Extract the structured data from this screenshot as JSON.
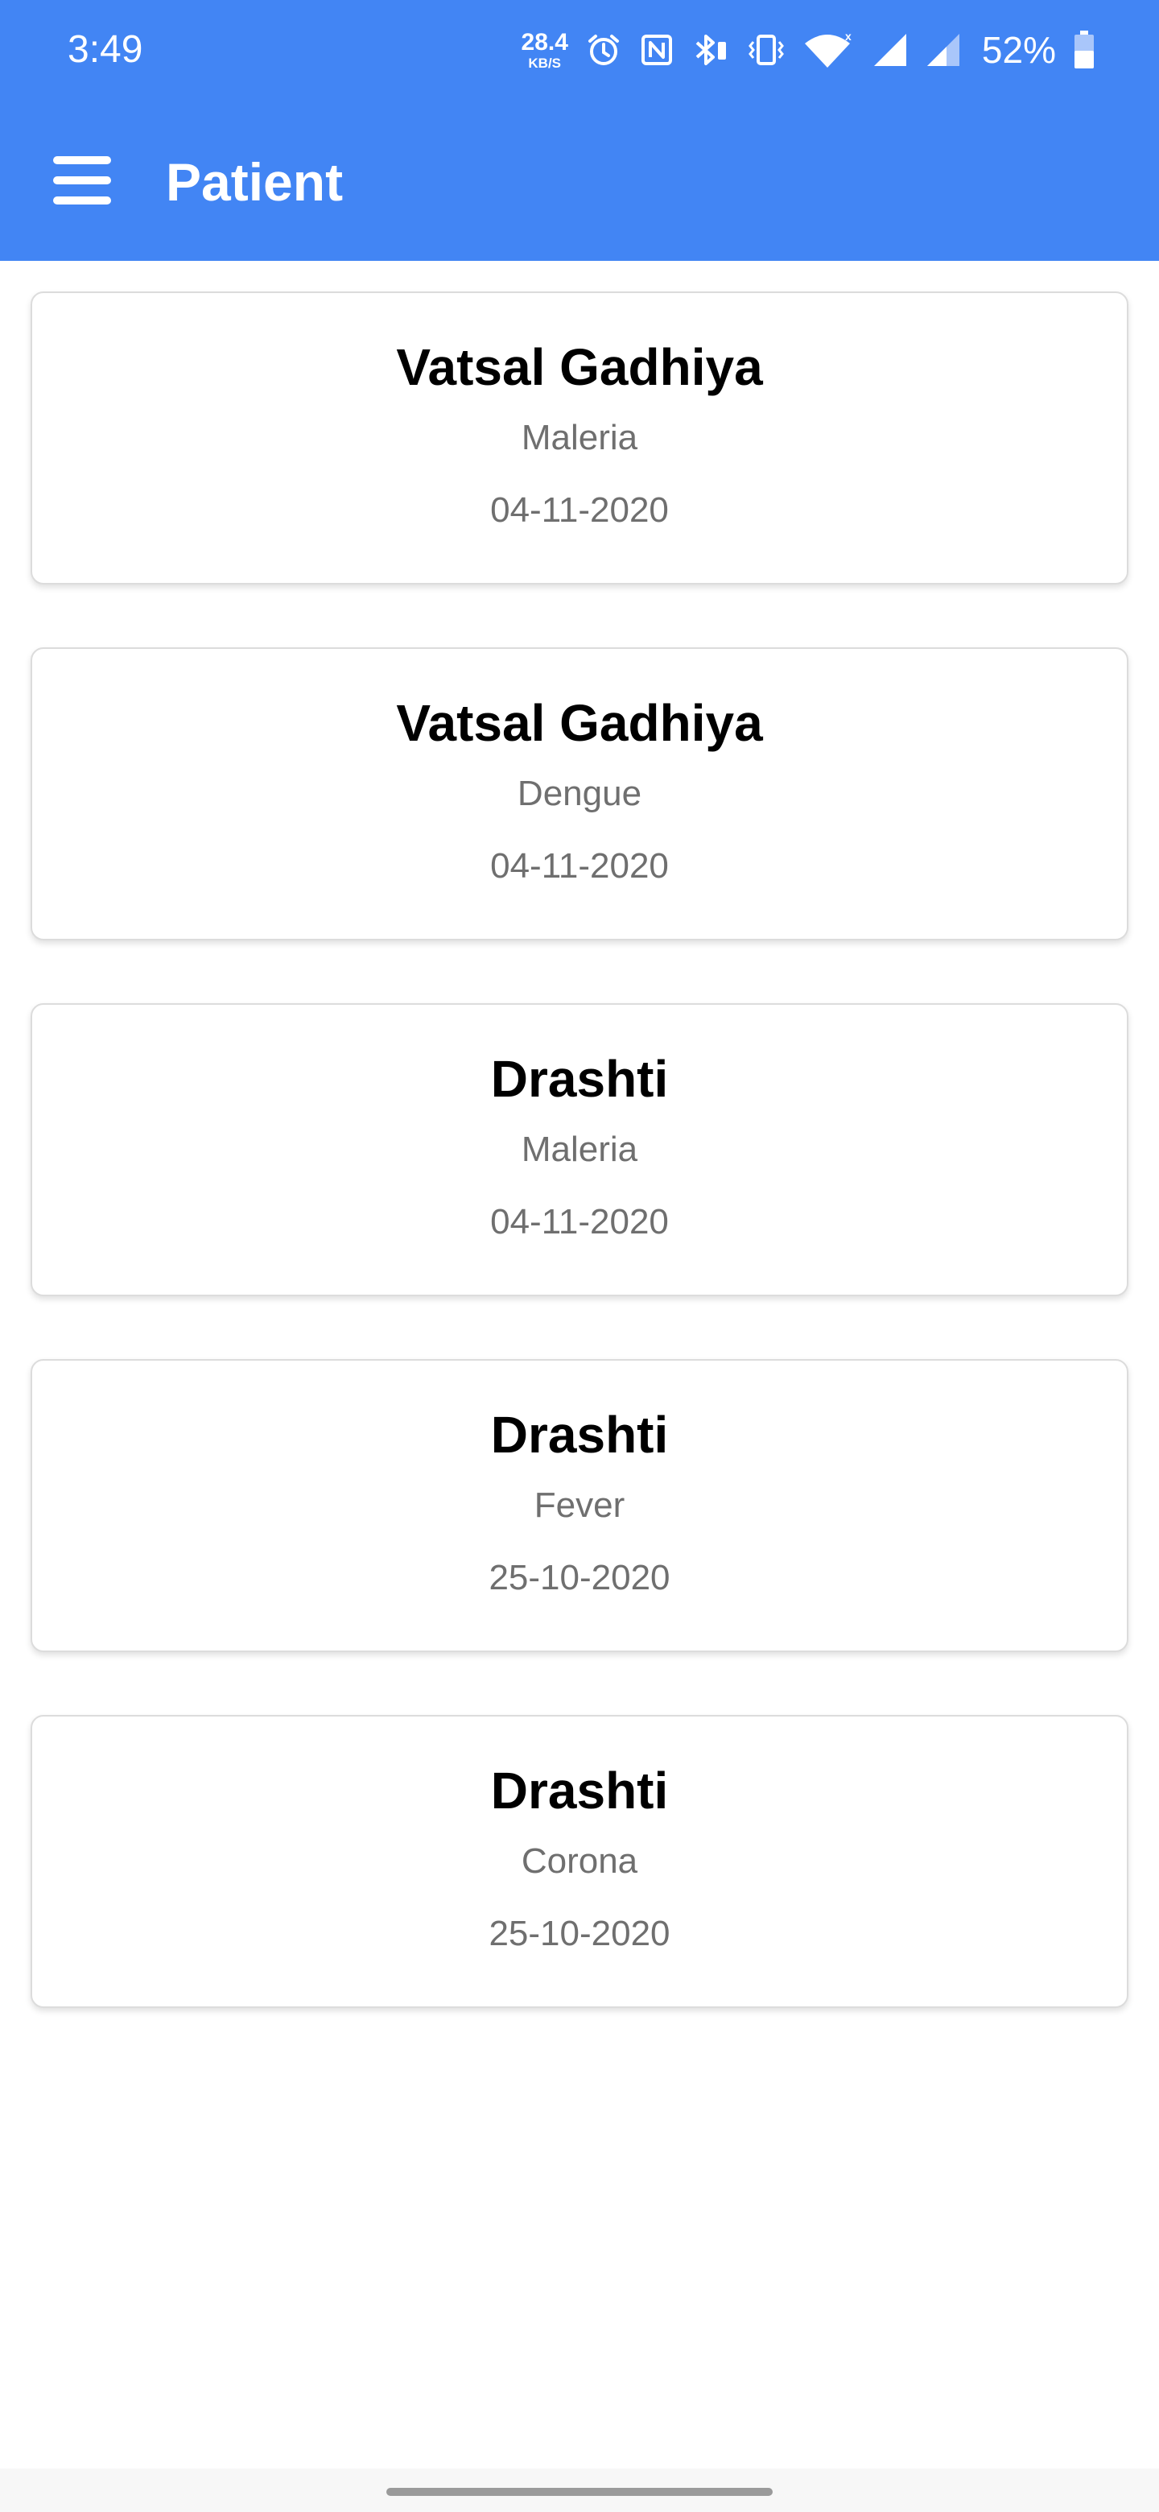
{
  "status_bar": {
    "time": "3:49",
    "net_speed_value": "28.4",
    "net_speed_unit": "KB/S",
    "battery_percent": "52%",
    "icons": [
      "alarm-icon",
      "nfc-icon",
      "bluetooth-icon",
      "vibrate-icon",
      "wifi-icon",
      "signal-icon",
      "signal-icon-2",
      "battery-icon"
    ]
  },
  "app_bar": {
    "title": "Patient",
    "menu_icon": "hamburger-menu-icon"
  },
  "patients": [
    {
      "name": "Vatsal Gadhiya",
      "disease": "Maleria",
      "date": "04-11-2020"
    },
    {
      "name": "Vatsal Gadhiya",
      "disease": "Dengue",
      "date": "04-11-2020"
    },
    {
      "name": "Drashti",
      "disease": "Maleria",
      "date": "04-11-2020"
    },
    {
      "name": "Drashti",
      "disease": "Fever",
      "date": "25-10-2020"
    },
    {
      "name": "Drashti",
      "disease": "Corona",
      "date": "25-10-2020"
    }
  ],
  "colors": {
    "primary": "#4285f4",
    "card_border": "#dcdcdc",
    "secondary_text": "#6f6f6f"
  }
}
